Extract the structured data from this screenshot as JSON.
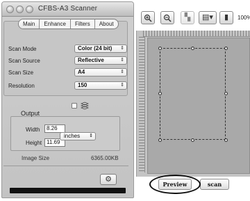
{
  "window": {
    "title": "CFBS-A3 Scanner"
  },
  "tabs": [
    {
      "label": "Main"
    },
    {
      "label": "Enhance"
    },
    {
      "label": "Filters"
    },
    {
      "label": "About"
    }
  ],
  "settings": {
    "scan_mode": {
      "label": "Scan Mode",
      "value": "Color (24 bit)"
    },
    "scan_source": {
      "label": "Scan Source",
      "value": "Reflective"
    },
    "scan_size": {
      "label": "Scan Size",
      "value": "A4"
    },
    "resolution": {
      "label": "Resolution",
      "value": "150"
    }
  },
  "output": {
    "legend": "Output",
    "width_label": "Width",
    "width_value": "8.26",
    "height_label": "Height",
    "height_value": "11.69",
    "unit": "inches"
  },
  "image_size": {
    "label": "Image Size",
    "value": "6365.00KB"
  },
  "toolbar": {
    "zoom_level": "100%"
  },
  "preview_panel": {
    "preview_label": "Preview",
    "scan_label": "scan"
  },
  "icons": {
    "zoom_in": "zoom-in-icon",
    "zoom_out": "zoom-out-icon",
    "gear": "gear-icon"
  }
}
